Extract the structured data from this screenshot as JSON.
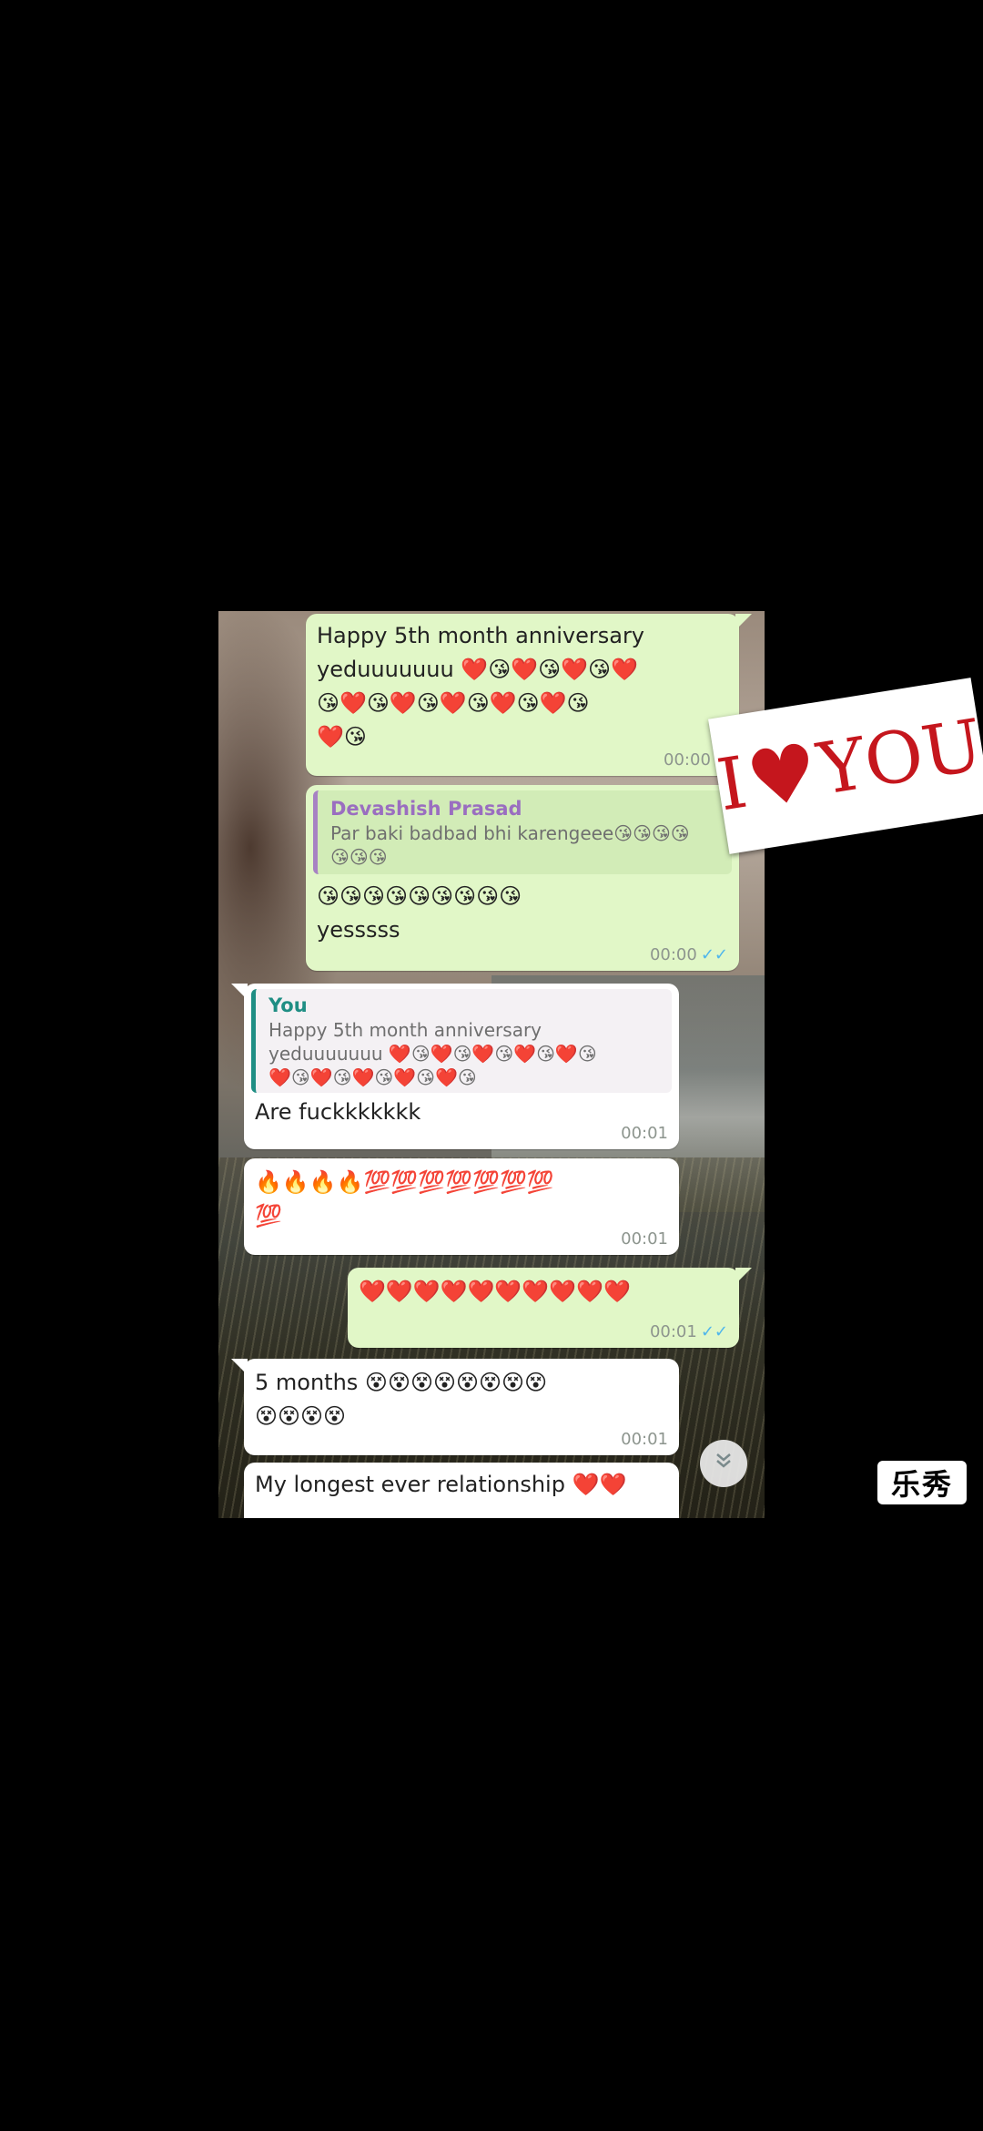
{
  "messages": {
    "m1": {
      "line1": "Happy 5th month anniversary",
      "line2": "yeduuuuuuu ❤️😘❤️😘❤️😘❤️",
      "line3": "😘❤️😘❤️😘❤️😘❤️😘❤️😘",
      "line4": "❤️😘",
      "time": "00:00",
      "ticks": "✓"
    },
    "m2": {
      "quote_name": "Devashish Prasad",
      "quote_line1": "Par baki badbad bhi karengeee😘😘😘😘",
      "quote_line2": "😘😘😘",
      "line1": "😘😘😘😘😘😘😘😘😘",
      "line2": "yesssss",
      "time": "00:00",
      "ticks": "✓✓"
    },
    "m3": {
      "quote_name": "You",
      "quote_line1": "Happy 5th month anniversary",
      "quote_line2": "yeduuuuuuu ❤️😘❤️😘❤️😘❤️😘❤️😘",
      "quote_line3": "❤️😘❤️😘❤️😘❤️😘❤️😘",
      "text": "Are fuckkkkkkk",
      "time": "00:01"
    },
    "m4": {
      "line1": "🔥🔥🔥🔥💯💯💯💯💯💯💯",
      "line2": "💯",
      "time": "00:01"
    },
    "m5": {
      "line1": "❤️❤️❤️❤️❤️❤️❤️❤️❤️❤️",
      "time": "00:01",
      "ticks": "✓✓"
    },
    "m6": {
      "line1": "5 months 😵😵😵😵😵😵😵😵",
      "line2": "😵😵😵😵",
      "time": "00:01"
    },
    "m7": {
      "text": "My longest ever relationship ❤️❤️"
    }
  },
  "scroll_down_icon": "double-chevron-down-icon",
  "sticker": {
    "left": "I",
    "heart": "♥",
    "right": "YOU"
  },
  "watermark": "乐秀",
  "colors": {
    "outgoing_bubble": "#e1f7c7",
    "incoming_bubble": "#ffffff",
    "read_ticks": "#4fb6ec",
    "quote_name_outgoing": "#9a6ec0",
    "quote_name_incoming": "#1f8e84",
    "sticker_red": "#c5161d"
  }
}
